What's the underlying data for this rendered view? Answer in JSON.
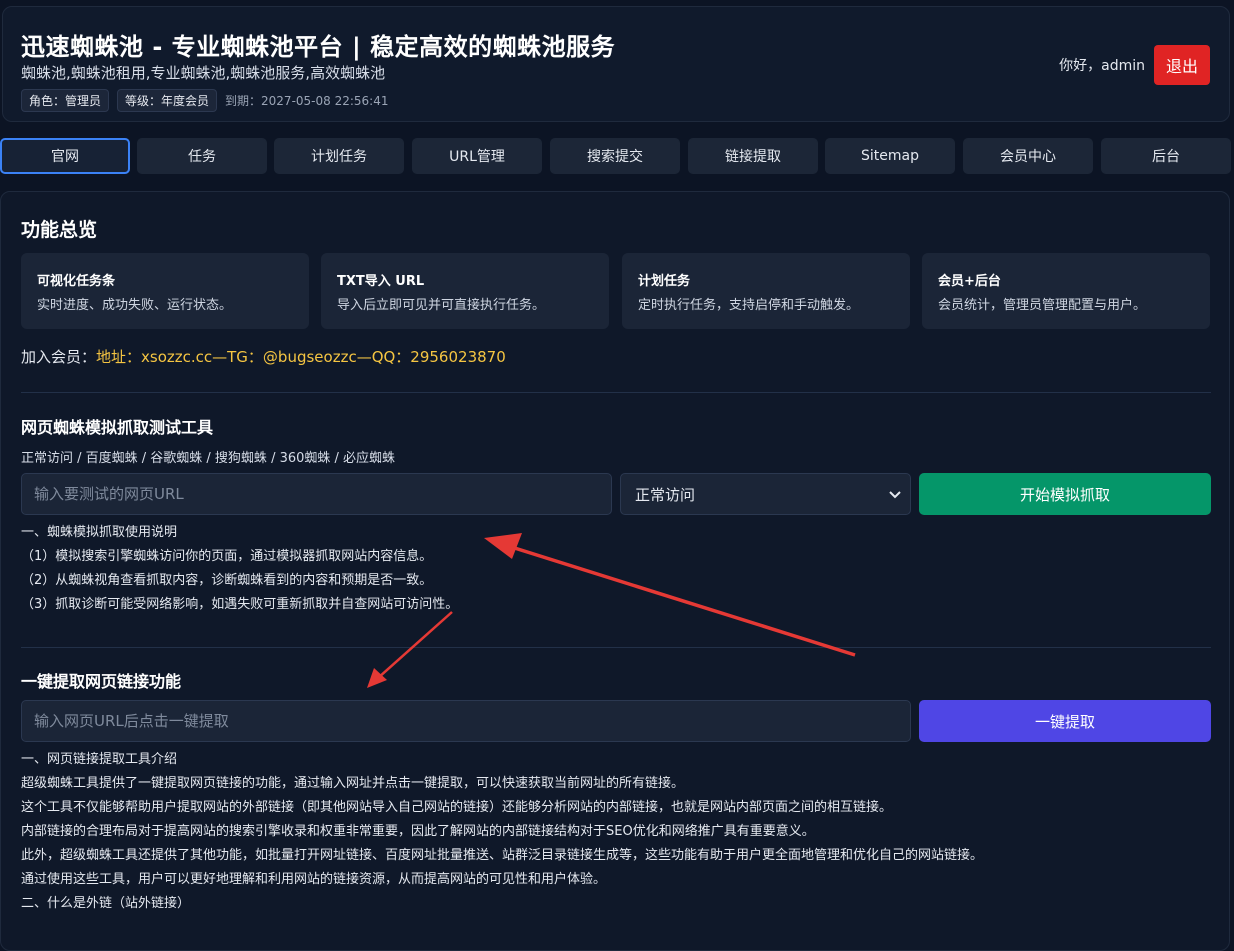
{
  "header": {
    "title": "迅速蜘蛛池 - 专业蜘蛛池平台 | 稳定高效的蜘蛛池服务",
    "keywords": "蜘蛛池,蜘蛛池租用,专业蜘蛛池,蜘蛛池服务,高效蜘蛛池",
    "role_badge": "角色：管理员",
    "level_badge": "等级：年度会员",
    "expire": "到期：2027-05-08 22:56:41",
    "greeting": "你好，admin",
    "logout_label": "退出"
  },
  "nav": {
    "items": [
      {
        "label": "官网",
        "active": true
      },
      {
        "label": "任务"
      },
      {
        "label": "计划任务"
      },
      {
        "label": "URL管理"
      },
      {
        "label": "搜索提交"
      },
      {
        "label": "链接提取"
      },
      {
        "label": "Sitemap"
      },
      {
        "label": "会员中心"
      },
      {
        "label": "后台"
      }
    ]
  },
  "overview": {
    "title": "功能总览",
    "cards": [
      {
        "title": "可视化任务条",
        "desc": "实时进度、成功失败、运行状态。"
      },
      {
        "title": "TXT导入 URL",
        "desc": "导入后立即可见并可直接执行任务。"
      },
      {
        "title": "计划任务",
        "desc": "定时执行任务，支持启停和手动触发。"
      },
      {
        "title": "会员+后台",
        "desc": "会员统计，管理员管理配置与用户。"
      }
    ],
    "join_label": "加入会员：",
    "join_contact": "地址：xsozzc.cc—TG：@bugseozzc—QQ：2956023870"
  },
  "crawl_tool": {
    "title": "网页蜘蛛模拟抓取测试工具",
    "modes": "正常访问 / 百度蜘蛛 / 谷歌蜘蛛 / 搜狗蜘蛛 / 360蜘蛛 / 必应蜘蛛",
    "url_placeholder": "输入要测试的网页URL",
    "selected_mode": "正常访问",
    "start_label": "开始模拟抓取",
    "instructions": [
      "一、蜘蛛模拟抓取使用说明",
      "（1）模拟搜索引擎蜘蛛访问你的页面，通过模拟器抓取网站内容信息。",
      "（2）从蜘蛛视角查看抓取内容，诊断蜘蛛看到的内容和预期是否一致。",
      "（3）抓取诊断可能受网络影响，如遇失败可重新抓取并自查网站可访问性。"
    ]
  },
  "link_tool": {
    "title": "一键提取网页链接功能",
    "url_placeholder": "输入网页URL后点击一键提取",
    "extract_label": "一键提取",
    "intro": [
      "一、网页链接提取工具介绍",
      "超级蜘蛛工具提供了一键提取网页链接的功能，通过输入网址并点击一键提取，可以快速获取当前网址的所有链接。",
      "这个工具不仅能够帮助用户提取网站的外部链接（即其他网站导入自己网站的链接）还能够分析网站的内部链接，也就是网站内部页面之间的相互链接。",
      "内部链接的合理布局对于提高网站的搜索引擎收录和权重非常重要，因此了解网站的内部链接结构对于SEO优化和网络推广具有重要意义。",
      "此外，超级蜘蛛工具还提供了其他功能，如批量打开网址链接、百度网址批量推送、站群泛目录链接生成等，这些功能有助于用户更全面地管理和优化自己的网站链接。",
      "通过使用这些工具，用户可以更好地理解和利用网站的链接资源，从而提高网站的可见性和用户体验。",
      "二、什么是外链（站外链接）"
    ]
  },
  "colors": {
    "background": "#0c1424",
    "logout": "#e02424",
    "start_button": "#059669",
    "extract_button": "#4f46e5",
    "contact_highlight": "#f5c542",
    "annotation_arrow": "#e53935"
  }
}
